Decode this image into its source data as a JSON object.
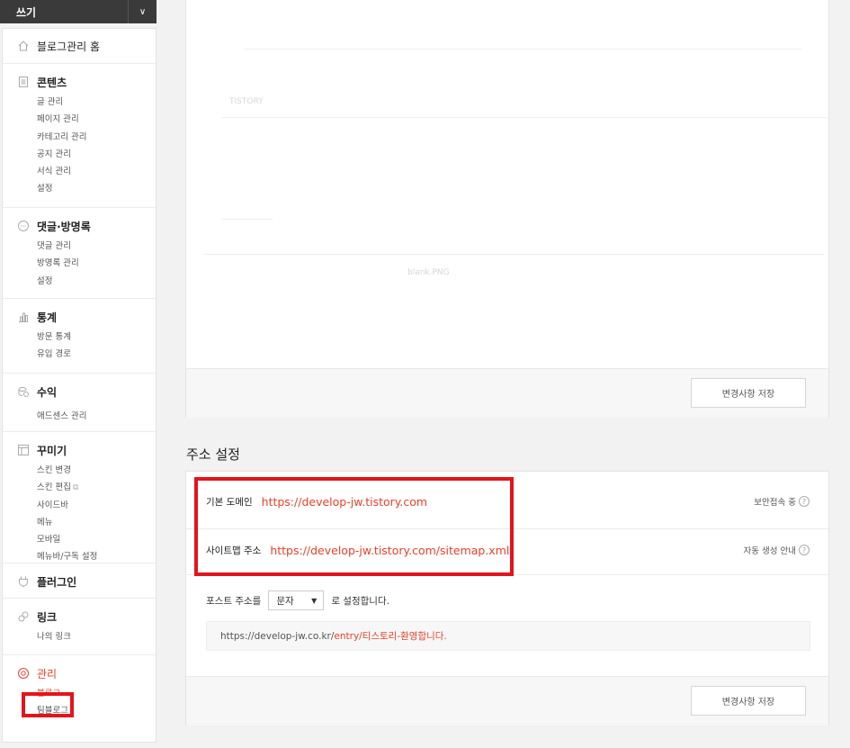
{
  "write_bar": {
    "label": "쓰기",
    "toggle_icon": "chevron-down-icon"
  },
  "sidebar": {
    "home": {
      "label": "블로그관리 홈",
      "icon": "home-icon"
    },
    "sections": [
      {
        "title": "콘텐츠",
        "icon": "document-icon",
        "items": [
          "글 관리",
          "페이지 관리",
          "카테고리 관리",
          "공지 관리",
          "서식 관리",
          "설정"
        ]
      },
      {
        "title": "댓글·방명록",
        "icon": "comment-icon",
        "items": [
          "댓글 관리",
          "방명록 관리",
          "설정"
        ]
      },
      {
        "title": "통계",
        "icon": "bar-chart-icon",
        "items": [
          "방문 통계",
          "유입 경로"
        ]
      },
      {
        "title": "수익",
        "icon": "coin-icon",
        "items": [
          "애드센스 관리"
        ]
      },
      {
        "title": "꾸미기",
        "icon": "layout-icon",
        "items": [
          "스킨 변경",
          "스킨 편집",
          "사이드바",
          "메뉴",
          "모바일",
          "메뉴바/구독 설정"
        ]
      },
      {
        "title": "플러그인",
        "icon": "plug-icon",
        "items": []
      },
      {
        "title": "링크",
        "icon": "link-icon",
        "items": [
          "나의 링크"
        ]
      },
      {
        "title": "관리",
        "icon": "gear-icon",
        "items": [
          "블로그",
          "팀블로그"
        ]
      }
    ]
  },
  "top_panel": {
    "faint_text_1": "TISTORY",
    "faint_text_2": "blank.PNG",
    "save_label": "변경사항 저장"
  },
  "address": {
    "section_title": "주소 설정",
    "domain_label": "기본 도메인",
    "domain_url": "https://develop-jw.tistory.com",
    "domain_right": "보안접속 중",
    "sitemap_label": "사이트맵 주소",
    "sitemap_url": "https://develop-jw.tistory.com/sitemap.xml",
    "sitemap_right": "자동 생성 안내",
    "post_prefix": "포스트 주소를",
    "post_select_value": "문자",
    "post_suffix": "로 설정합니다.",
    "example_base": "https://develop-jw.co.kr/",
    "example_path": "entry/티스토리-환영합니다.",
    "save_label": "변경사항 저장"
  },
  "colors": {
    "accent": "#e8412b",
    "highlight_box": "#e3141b",
    "dark_bar": "#3a3a3a"
  }
}
